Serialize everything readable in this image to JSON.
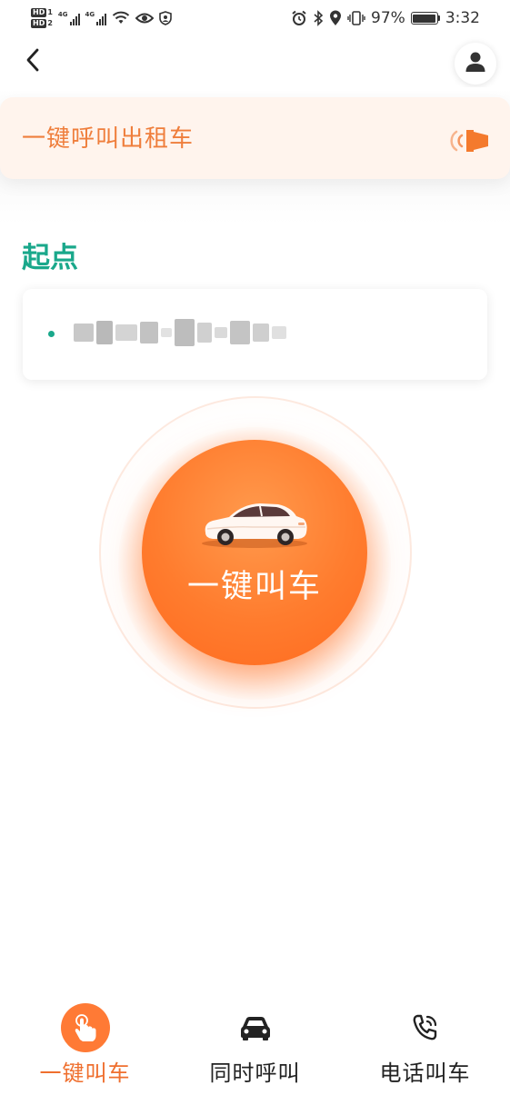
{
  "status_bar": {
    "hd1": "HD",
    "hd1_num": "1",
    "hd2": "HD",
    "hd2_num": "2",
    "net1": "4G",
    "net2": "4G",
    "battery_text": "97%",
    "battery_level": 0.97,
    "time": "3:32"
  },
  "header": {
    "back_icon": "chevron-left-icon",
    "avatar_icon": "user-icon"
  },
  "banner": {
    "title": "一键呼叫出租车",
    "icon": "speaker-icon",
    "accent": "#ef7e3c"
  },
  "start": {
    "label": "起点",
    "address": "",
    "accent": "#1aa88b"
  },
  "call_button": {
    "label": "一键叫车",
    "icon": "car-icon",
    "color": "#ff7c2e"
  },
  "tabs": [
    {
      "label": "一键叫车",
      "icon": "tap-hand-icon",
      "active": true
    },
    {
      "label": "同时呼叫",
      "icon": "car-front-icon",
      "active": false
    },
    {
      "label": "电话叫车",
      "icon": "phone-icon",
      "active": false
    }
  ]
}
